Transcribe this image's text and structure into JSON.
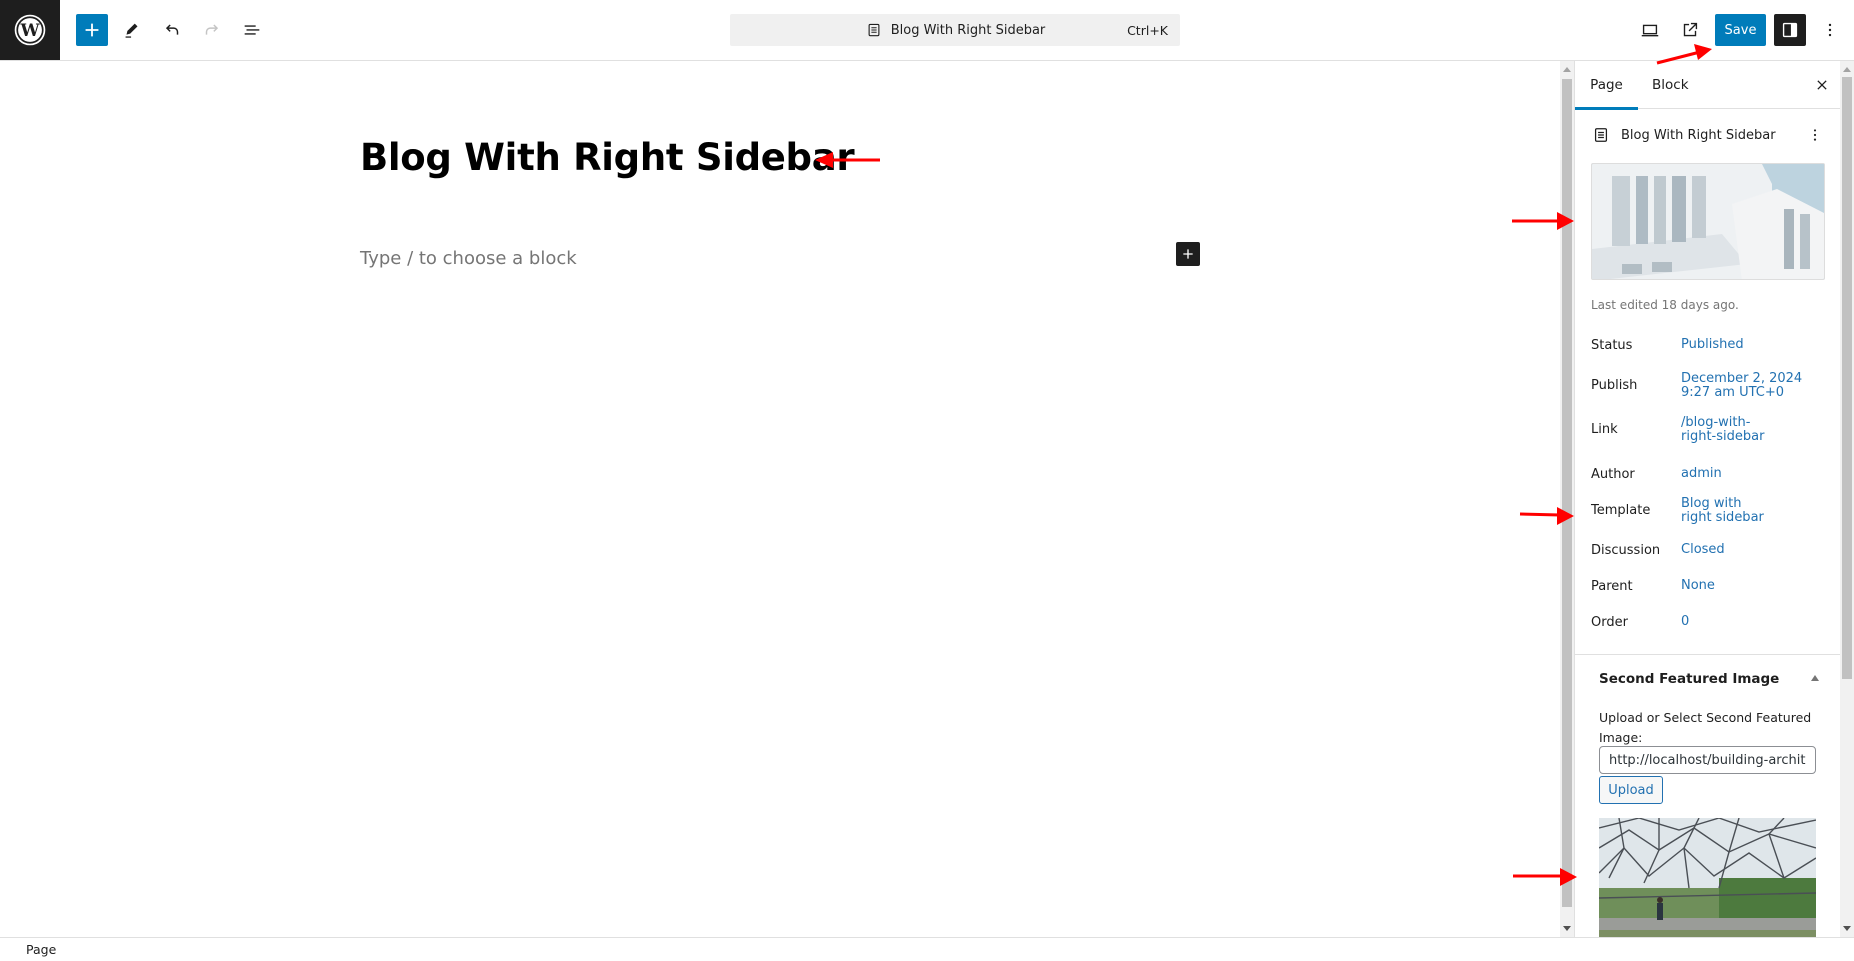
{
  "header": {
    "logo_icon": "wordpress-logo-icon",
    "toolbar": {
      "inserter_icon": "plus-icon",
      "tools_icon": "pencil-icon",
      "undo_icon": "undo-icon",
      "redo_icon": "redo-icon",
      "list_view_icon": "list-view-icon"
    },
    "command_bar": {
      "title": "Blog With Right Sidebar",
      "shortcut": "Ctrl+K"
    },
    "actions": {
      "save_label": "Save"
    }
  },
  "canvas": {
    "post_title": "Blog With Right Sidebar",
    "block_placeholder": "Type / to choose a block"
  },
  "sidebar": {
    "tabs": [
      {
        "label": "Page",
        "active": true
      },
      {
        "label": "Block",
        "active": false
      }
    ],
    "document": {
      "title": "Blog With Right Sidebar"
    },
    "last_edited": "Last edited 18 days ago.",
    "meta": [
      {
        "label": "Status",
        "value": "Published"
      },
      {
        "label": "Publish",
        "value": "December 2, 2024\n9:27 am UTC+0"
      },
      {
        "label": "Link",
        "value": "/blog-with-\nright-sidebar"
      },
      {
        "label": "Author",
        "value": "admin"
      },
      {
        "label": "Template",
        "value": "Blog with\nright sidebar"
      },
      {
        "label": "Discussion",
        "value": "Closed"
      },
      {
        "label": "Parent",
        "value": "None"
      },
      {
        "label": "Order",
        "value": "0"
      }
    ],
    "second_featured_image": {
      "title": "Second Featured Image",
      "upload_label": "Upload or Select Second Featured Image:",
      "url_value": "http://localhost/building-archite",
      "upload_button": "Upload"
    }
  },
  "footer": {
    "breadcrumb": "Page"
  },
  "colors": {
    "accent": "#007cba",
    "link": "#2271b1",
    "dark": "#1e1e1e",
    "annotation": "#ff0000"
  }
}
